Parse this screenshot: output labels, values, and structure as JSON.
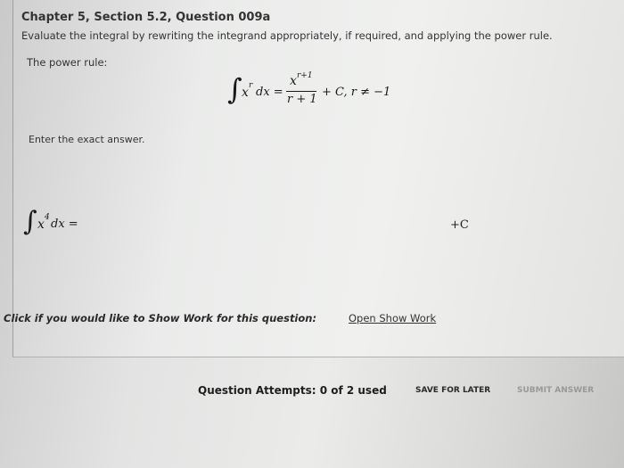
{
  "question": {
    "title": "Chapter 5, Section 5.2, Question 009a",
    "instructions": "Evaluate the integral by rewriting the integrand appropriately, if required, and applying the power rule.",
    "power_rule_label": "The power rule:"
  },
  "formula": {
    "integral": "∫",
    "base": "x",
    "exponent": "r",
    "dx": "dx =",
    "numerator_base": "x",
    "numerator_exp": "r+1",
    "denominator": "r + 1",
    "tail": "+ C, r ≠ −1"
  },
  "answer": {
    "prompt": "Enter the exact answer.",
    "integral": "∫",
    "base": "x",
    "exponent": "4",
    "dx": "dx =",
    "constant": "+C",
    "input_value": ""
  },
  "show_work": {
    "prompt": "Click if you would like to Show Work for this question:",
    "link": "Open Show Work"
  },
  "footer": {
    "attempts": "Question Attempts: 0 of 2 used",
    "save_later": "SAVE FOR LATER",
    "submit": "SUBMIT ANSWER"
  }
}
